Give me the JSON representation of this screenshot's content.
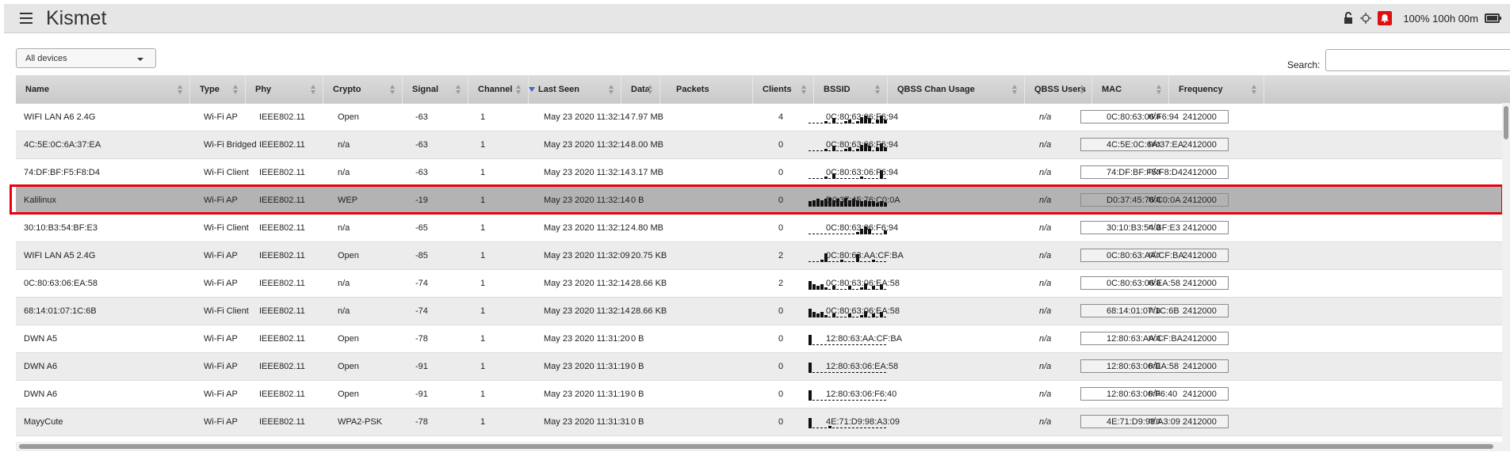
{
  "app": {
    "title": "Kismet",
    "status": "100% 100h 00m"
  },
  "controls": {
    "view_select": "All devices",
    "search_label": "Search:",
    "search_value": ""
  },
  "columns": [
    "Name",
    "Type",
    "Phy",
    "Crypto",
    "Signal",
    "Channel",
    "Last Seen",
    "Data",
    "Packets",
    "Clients",
    "BSSID",
    "QBSS Chan Usage",
    "QBSS Users",
    "MAC",
    "Frequency"
  ],
  "sorted_column": "Channel",
  "colors": {
    "selected_row": "#b3b3b3",
    "highlight_outline": "#e8000e",
    "alert": "#e01010"
  },
  "rows": [
    {
      "name": "WIFI LAN A6 2.4G",
      "type": "Wi-Fi AP",
      "phy": "IEEE802.11",
      "crypto": "Open",
      "signal": "-63",
      "channel": "1",
      "last_seen": "May 23 2020 11:32:14",
      "data": "7.97 MB",
      "packets": [
        1,
        1,
        1,
        1,
        2,
        1,
        4,
        1,
        1,
        2,
        3,
        1,
        2,
        5,
        6,
        4,
        1,
        3,
        6,
        3
      ],
      "clients": "4",
      "bssid": "0C:80:63:06:F6:94",
      "qbss": "n/a",
      "qbss_users": "n/a",
      "mac": "0C:80:63:06:F6:94",
      "frequency": "2412000",
      "selected": false
    },
    {
      "name": "4C:5E:0C:6A:37:EA",
      "type": "Wi-Fi Bridged",
      "phy": "IEEE802.11",
      "crypto": "n/a",
      "signal": "-63",
      "channel": "1",
      "last_seen": "May 23 2020 11:32:14",
      "data": "8.00 MB",
      "packets": [
        1,
        1,
        1,
        1,
        2,
        1,
        4,
        1,
        1,
        2,
        3,
        1,
        2,
        5,
        6,
        4,
        1,
        3,
        6,
        3
      ],
      "clients": "0",
      "bssid": "0C:80:63:06:F6:94",
      "qbss": "n/a",
      "qbss_users": "n/a",
      "mac": "4C:5E:0C:6A:37:EA",
      "frequency": "2412000",
      "selected": false
    },
    {
      "name": "74:DF:BF:F5:F8:D4",
      "type": "Wi-Fi Client",
      "phy": "IEEE802.11",
      "crypto": "n/a",
      "signal": "-63",
      "channel": "1",
      "last_seen": "May 23 2020 11:32:14",
      "data": "3.17 MB",
      "packets": [
        1,
        1,
        1,
        1,
        2,
        1,
        4,
        1,
        1,
        1,
        1,
        1,
        1,
        2,
        1,
        1,
        1,
        1,
        7,
        1
      ],
      "clients": "0",
      "bssid": "0C:80:63:06:F6:94",
      "qbss": "n/a",
      "qbss_users": "n/a",
      "mac": "74:DF:BF:F5:F8:D4",
      "frequency": "2412000",
      "selected": false
    },
    {
      "name": "Kalilinux",
      "type": "Wi-Fi AP",
      "phy": "IEEE802.11",
      "crypto": "WEP",
      "signal": "-19",
      "channel": "1",
      "last_seen": "May 23 2020 11:32:14",
      "data": "0 B",
      "packets": [
        4,
        5,
        6,
        5,
        6,
        7,
        5,
        6,
        4,
        7,
        5,
        6,
        5,
        4,
        5,
        4,
        4,
        3,
        4,
        3
      ],
      "clients": "0",
      "bssid": "D0:37:45:76:C0:0A",
      "qbss": "n/a",
      "qbss_users": "n/a",
      "mac": "D0:37:45:76:C0:0A",
      "frequency": "2412000",
      "selected": true
    },
    {
      "name": "30:10:B3:54:BF:E3",
      "type": "Wi-Fi Client",
      "phy": "IEEE802.11",
      "crypto": "n/a",
      "signal": "-65",
      "channel": "1",
      "last_seen": "May 23 2020 11:32:12",
      "data": "4.80 MB",
      "packets": [
        1,
        1,
        1,
        1,
        1,
        1,
        1,
        1,
        1,
        1,
        1,
        1,
        2,
        4,
        6,
        4,
        1,
        1,
        1,
        3
      ],
      "clients": "0",
      "bssid": "0C:80:63:06:F6:94",
      "qbss": "n/a",
      "qbss_users": "n/a",
      "mac": "30:10:B3:54:BF:E3",
      "frequency": "2412000",
      "selected": false
    },
    {
      "name": "WIFI LAN A5 2.4G",
      "type": "Wi-Fi AP",
      "phy": "IEEE802.11",
      "crypto": "Open",
      "signal": "-85",
      "channel": "1",
      "last_seen": "May 23 2020 11:32:09",
      "data": "20.75 KB",
      "packets": [
        1,
        1,
        1,
        2,
        7,
        1,
        1,
        1,
        2,
        1,
        1,
        1,
        6,
        1,
        1,
        1,
        2,
        1,
        1,
        1
      ],
      "clients": "2",
      "bssid": "0C:80:63:AA:CF:BA",
      "qbss": "n/a",
      "qbss_users": "n/a",
      "mac": "0C:80:63:AA:CF:BA",
      "frequency": "2412000",
      "selected": false
    },
    {
      "name": "0C:80:63:06:EA:58",
      "type": "Wi-Fi AP",
      "phy": "IEEE802.11",
      "crypto": "n/a",
      "signal": "-74",
      "channel": "1",
      "last_seen": "May 23 2020 11:32:14",
      "data": "28.66 KB",
      "packets": [
        7,
        4,
        3,
        4,
        2,
        1,
        3,
        1,
        1,
        1,
        3,
        1,
        1,
        2,
        5,
        1,
        3,
        1,
        4,
        1
      ],
      "clients": "2",
      "bssid": "0C:80:63:06:EA:58",
      "qbss": "n/a",
      "qbss_users": "n/a",
      "mac": "0C:80:63:06:EA:58",
      "frequency": "2412000",
      "selected": false
    },
    {
      "name": "68:14:01:07:1C:6B",
      "type": "Wi-Fi Client",
      "phy": "IEEE802.11",
      "crypto": "n/a",
      "signal": "-74",
      "channel": "1",
      "last_seen": "May 23 2020 11:32:14",
      "data": "28.66 KB",
      "packets": [
        7,
        4,
        3,
        4,
        2,
        1,
        3,
        1,
        1,
        1,
        3,
        1,
        1,
        2,
        5,
        1,
        3,
        1,
        4,
        1
      ],
      "clients": "0",
      "bssid": "0C:80:63:06:EA:58",
      "qbss": "n/a",
      "qbss_users": "n/a",
      "mac": "68:14:01:07:1C:6B",
      "frequency": "2412000",
      "selected": false
    },
    {
      "name": "DWN A5",
      "type": "Wi-Fi AP",
      "phy": "IEEE802.11",
      "crypto": "Open",
      "signal": "-78",
      "channel": "1",
      "last_seen": "May 23 2020 11:31:20",
      "data": "0 B",
      "packets": [
        8,
        1,
        1,
        1,
        1,
        1,
        1,
        1,
        1,
        1,
        1,
        1,
        1,
        1,
        1,
        1,
        1,
        1,
        1,
        1
      ],
      "clients": "0",
      "bssid": "12:80:63:AA:CF:BA",
      "qbss": "n/a",
      "qbss_users": "n/a",
      "mac": "12:80:63:AA:CF:BA",
      "frequency": "2412000",
      "selected": false
    },
    {
      "name": "DWN A6",
      "type": "Wi-Fi AP",
      "phy": "IEEE802.11",
      "crypto": "Open",
      "signal": "-91",
      "channel": "1",
      "last_seen": "May 23 2020 11:31:19",
      "data": "0 B",
      "packets": [
        8,
        1,
        1,
        1,
        1,
        1,
        1,
        1,
        1,
        1,
        1,
        1,
        1,
        1,
        1,
        1,
        1,
        1,
        1,
        1
      ],
      "clients": "0",
      "bssid": "12:80:63:06:EA:58",
      "qbss": "n/a",
      "qbss_users": "n/a",
      "mac": "12:80:63:06:EA:58",
      "frequency": "2412000",
      "selected": false
    },
    {
      "name": "DWN A6",
      "type": "Wi-Fi AP",
      "phy": "IEEE802.11",
      "crypto": "Open",
      "signal": "-91",
      "channel": "1",
      "last_seen": "May 23 2020 11:31:19",
      "data": "0 B",
      "packets": [
        8,
        1,
        1,
        1,
        1,
        1,
        1,
        1,
        1,
        1,
        1,
        1,
        1,
        1,
        1,
        1,
        1,
        1,
        1,
        1
      ],
      "clients": "0",
      "bssid": "12:80:63:06:F6:40",
      "qbss": "n/a",
      "qbss_users": "n/a",
      "mac": "12:80:63:06:F6:40",
      "frequency": "2412000",
      "selected": false
    },
    {
      "name": "MayyCute",
      "type": "Wi-Fi AP",
      "phy": "IEEE802.11",
      "crypto": "WPA2-PSK",
      "signal": "-78",
      "channel": "1",
      "last_seen": "May 23 2020 11:31:31",
      "data": "0 B",
      "packets": [
        8,
        1,
        1,
        1,
        1,
        2,
        1,
        1,
        1,
        1,
        1,
        1,
        1,
        1,
        1,
        1,
        1,
        1,
        1,
        1
      ],
      "clients": "0",
      "bssid": "4E:71:D9:98:A3:09",
      "qbss": "n/a",
      "qbss_users": "n/a",
      "mac": "4E:71:D9:98:A3:09",
      "frequency": "2412000",
      "selected": false
    }
  ]
}
